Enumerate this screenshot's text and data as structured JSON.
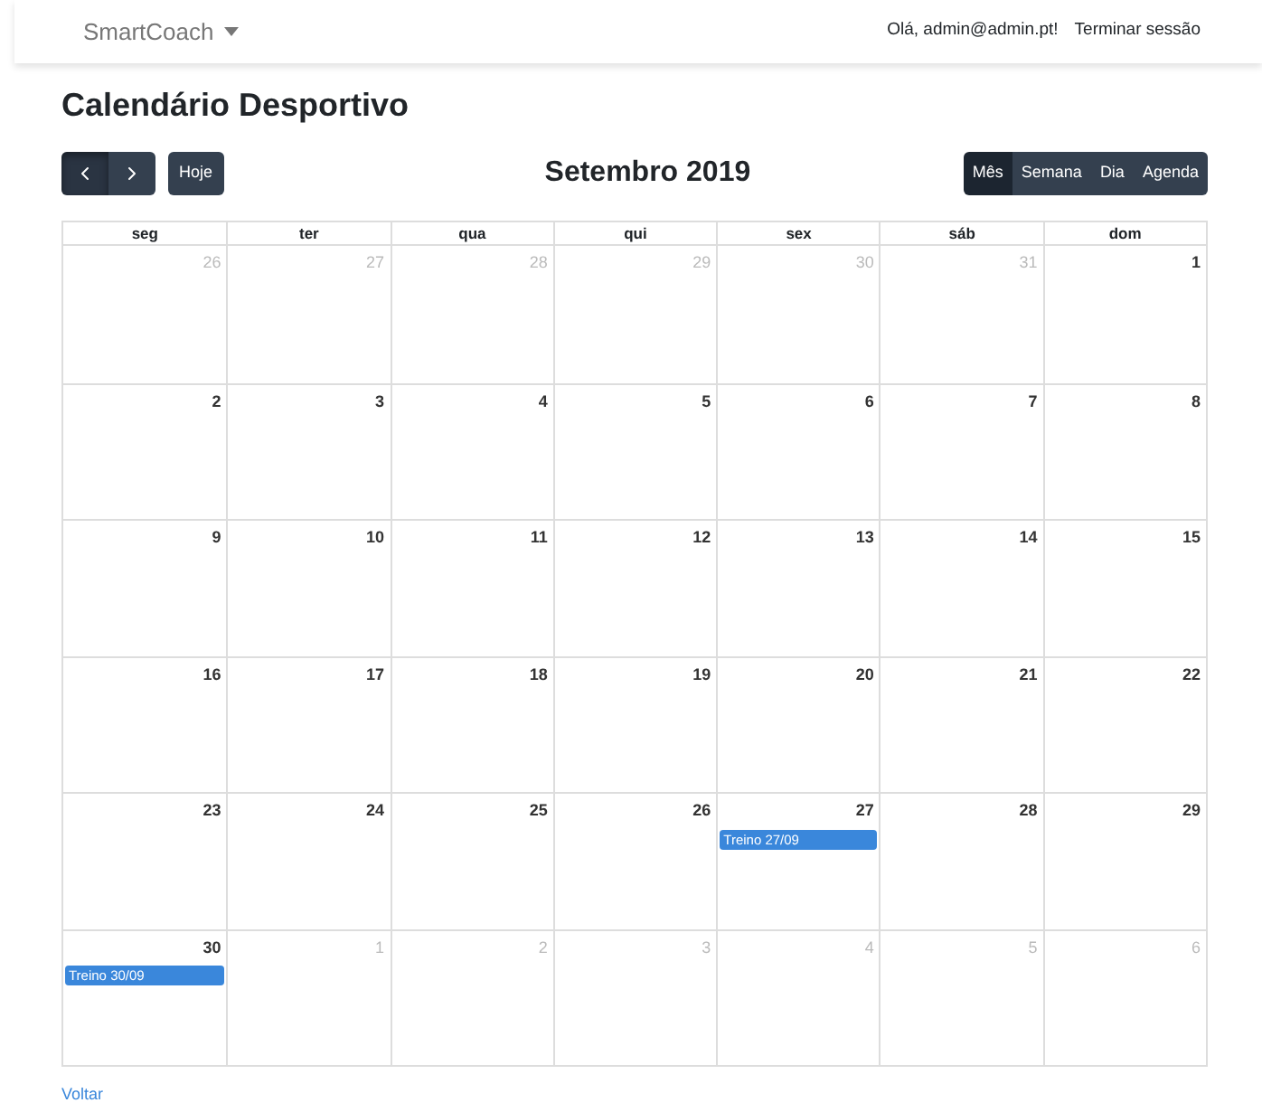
{
  "navbar": {
    "brand": "SmartCoach",
    "greeting": "Olá, admin@admin.pt!",
    "logout": "Terminar sessão"
  },
  "title": "Calendário Desportivo",
  "toolbar": {
    "nav_buttons": [
      {
        "kind": "prev",
        "selected": true
      },
      {
        "kind": "next",
        "selected": false
      }
    ],
    "today": "Hoje",
    "period": "Setembro 2019",
    "views": [
      {
        "label": "Mês",
        "selected": true
      },
      {
        "label": "Semana",
        "selected": false
      },
      {
        "label": "Dia",
        "selected": false
      },
      {
        "label": "Agenda",
        "selected": false
      }
    ]
  },
  "weekdays": [
    "seg",
    "ter",
    "qua",
    "qui",
    "sex",
    "sáb",
    "dom"
  ],
  "weeks": [
    [
      {
        "day": "26",
        "other_month": true
      },
      {
        "day": "27",
        "other_month": true
      },
      {
        "day": "28",
        "other_month": true
      },
      {
        "day": "29",
        "other_month": true
      },
      {
        "day": "30",
        "other_month": true
      },
      {
        "day": "31",
        "other_month": true
      },
      {
        "day": "1",
        "other_month": false
      }
    ],
    [
      {
        "day": "2",
        "other_month": false
      },
      {
        "day": "3",
        "other_month": false
      },
      {
        "day": "4",
        "other_month": false
      },
      {
        "day": "5",
        "other_month": false
      },
      {
        "day": "6",
        "other_month": false
      },
      {
        "day": "7",
        "other_month": false
      },
      {
        "day": "8",
        "other_month": false
      }
    ],
    [
      {
        "day": "9",
        "other_month": false
      },
      {
        "day": "10",
        "other_month": false
      },
      {
        "day": "11",
        "other_month": false
      },
      {
        "day": "12",
        "other_month": false
      },
      {
        "day": "13",
        "other_month": false
      },
      {
        "day": "14",
        "other_month": false
      },
      {
        "day": "15",
        "other_month": false
      }
    ],
    [
      {
        "day": "16",
        "other_month": false
      },
      {
        "day": "17",
        "other_month": false
      },
      {
        "day": "18",
        "other_month": false
      },
      {
        "day": "19",
        "other_month": false
      },
      {
        "day": "20",
        "other_month": false
      },
      {
        "day": "21",
        "other_month": false
      },
      {
        "day": "22",
        "other_month": false
      }
    ],
    [
      {
        "day": "23",
        "other_month": false
      },
      {
        "day": "24",
        "other_month": false
      },
      {
        "day": "25",
        "other_month": false
      },
      {
        "day": "26",
        "other_month": false
      },
      {
        "day": "27",
        "other_month": false,
        "events": [
          "Treino 27/09"
        ]
      },
      {
        "day": "28",
        "other_month": false
      },
      {
        "day": "29",
        "other_month": false
      }
    ],
    [
      {
        "day": "30",
        "other_month": false,
        "events": [
          "Treino 30/09"
        ]
      },
      {
        "day": "1",
        "other_month": true
      },
      {
        "day": "2",
        "other_month": true
      },
      {
        "day": "3",
        "other_month": true
      },
      {
        "day": "4",
        "other_month": true
      },
      {
        "day": "5",
        "other_month": true
      },
      {
        "day": "6",
        "other_month": true
      }
    ]
  ],
  "back_link": "Voltar"
}
